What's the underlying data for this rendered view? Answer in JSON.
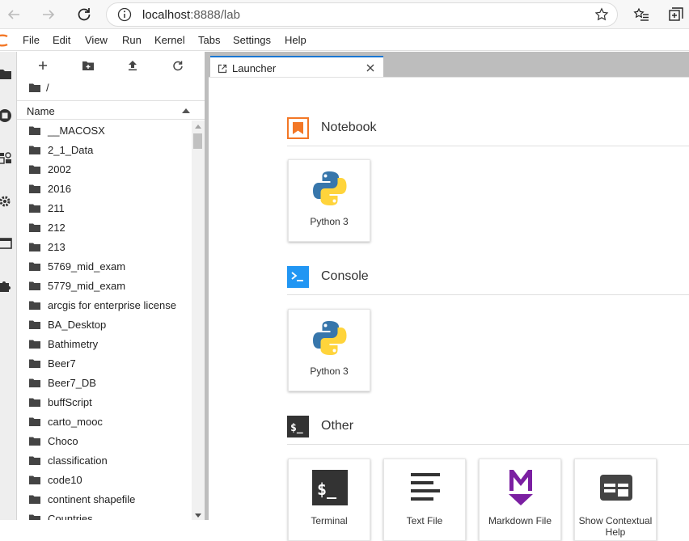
{
  "browser": {
    "url_host": "localhost",
    "url_rest": ":8888/lab"
  },
  "menu": [
    "File",
    "Edit",
    "View",
    "Run",
    "Kernel",
    "Tabs",
    "Settings",
    "Help"
  ],
  "filebrowser": {
    "breadcrumb": "/",
    "column_name": "Name",
    "files": [
      "__MACOSX",
      "2_1_Data",
      "2002",
      "2016",
      "211",
      "212",
      "213",
      "5769_mid_exam",
      "5779_mid_exam",
      "arcgis for enterprise license",
      "BA_Desktop",
      "Bathimetry",
      "Beer7",
      "Beer7_DB",
      "buffScript",
      "carto_mooc",
      "Choco",
      "classification",
      "code10",
      "continent shapefile",
      "Countries"
    ]
  },
  "tab": {
    "label": "Launcher"
  },
  "launcher": {
    "notebook_title": "Notebook",
    "console_title": "Console",
    "other_title": "Other",
    "notebook_card": "Python 3",
    "console_card": "Python 3",
    "other_cards": [
      "Terminal",
      "Text File",
      "Markdown File",
      "Show Contextual Help"
    ]
  },
  "colors": {
    "accent": "#1976d2",
    "notebook_icon": "#f37726",
    "console_icon": "#2196f3",
    "markdown_icon": "#7b1fa2",
    "terminal_icon": "#333333"
  }
}
